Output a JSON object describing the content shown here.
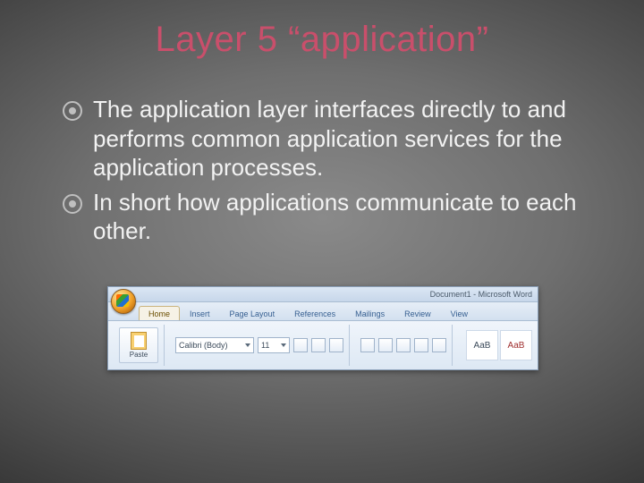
{
  "title": "Layer 5 “application”",
  "bullets": [
    "The application layer interfaces directly to and performs common application services for the application processes.",
    "In short how applications communicate to each other."
  ],
  "word": {
    "titlebar": "Document1 - Microsoft Word",
    "tabs": [
      "Home",
      "Insert",
      "Page Layout",
      "References",
      "Mailings",
      "Review",
      "View"
    ],
    "paste": "Paste",
    "font": "Calibri (Body)",
    "size": "11",
    "styleA": "AaB",
    "styleB": "AaB"
  }
}
